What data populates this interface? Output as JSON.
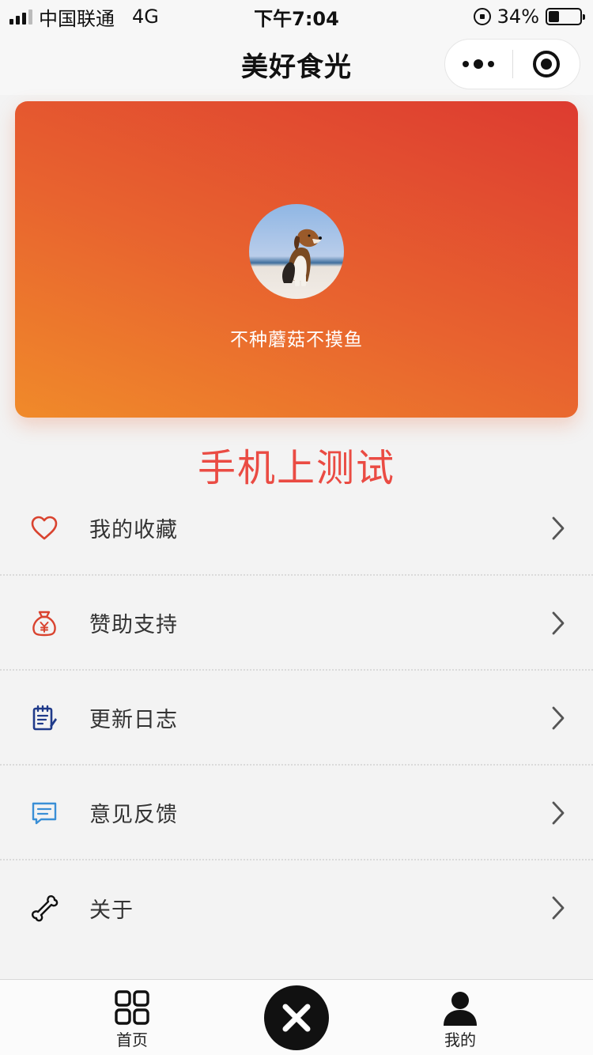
{
  "status_bar": {
    "carrier": "中国联通",
    "network": "4G",
    "time": "下午7:04",
    "battery": "34%",
    "battery_level": 0.34
  },
  "nav": {
    "title": "美好食光"
  },
  "profile": {
    "nickname": "不种蘑菇不摸鱼"
  },
  "banner": {
    "text": "手机上测试"
  },
  "menu": {
    "items": [
      {
        "label": "我的收藏",
        "icon": "heart-icon",
        "color": "#d9432f"
      },
      {
        "label": "赞助支持",
        "icon": "money-bag-icon",
        "color": "#d9432f"
      },
      {
        "label": "更新日志",
        "icon": "notepad-icon",
        "color": "#1f3a8a"
      },
      {
        "label": "意见反馈",
        "icon": "chat-icon",
        "color": "#3a8fd6"
      },
      {
        "label": "关于",
        "icon": "bone-icon",
        "color": "#111111"
      }
    ]
  },
  "tabbar": {
    "home_label": "首页",
    "mine_label": "我的"
  },
  "colors": {
    "card_gradient_start": "#f08a2a",
    "card_gradient_end": "#dd3b30",
    "banner": "#ea4b43"
  }
}
